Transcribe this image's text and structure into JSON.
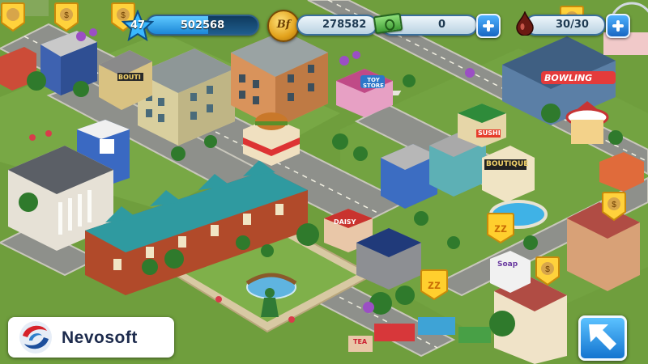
{
  "hud": {
    "level": "47",
    "xp_value": "502568",
    "xp_progress": 0.55,
    "coin_symbol": "Bf",
    "coins": "278582",
    "cash": "0",
    "energy": "30/30"
  },
  "map": {
    "signs": {
      "toy_store": "TOY STORE",
      "boutique_left": "BOUTI",
      "boutique_right": "BOUTIQUE",
      "sushi": "SUSHI",
      "bowling": "BOWLING",
      "daisy": "DAISY",
      "soap": "Soap",
      "tea": "TEA"
    }
  },
  "brand": {
    "name": "Nevosoft"
  },
  "colors": {
    "grass": "#6b9a3c",
    "road": "#8d8f8a",
    "hud_blue": "#2e5f8a",
    "button_blue": "#1f7bd6",
    "coin_gold": "#e2a21c"
  }
}
